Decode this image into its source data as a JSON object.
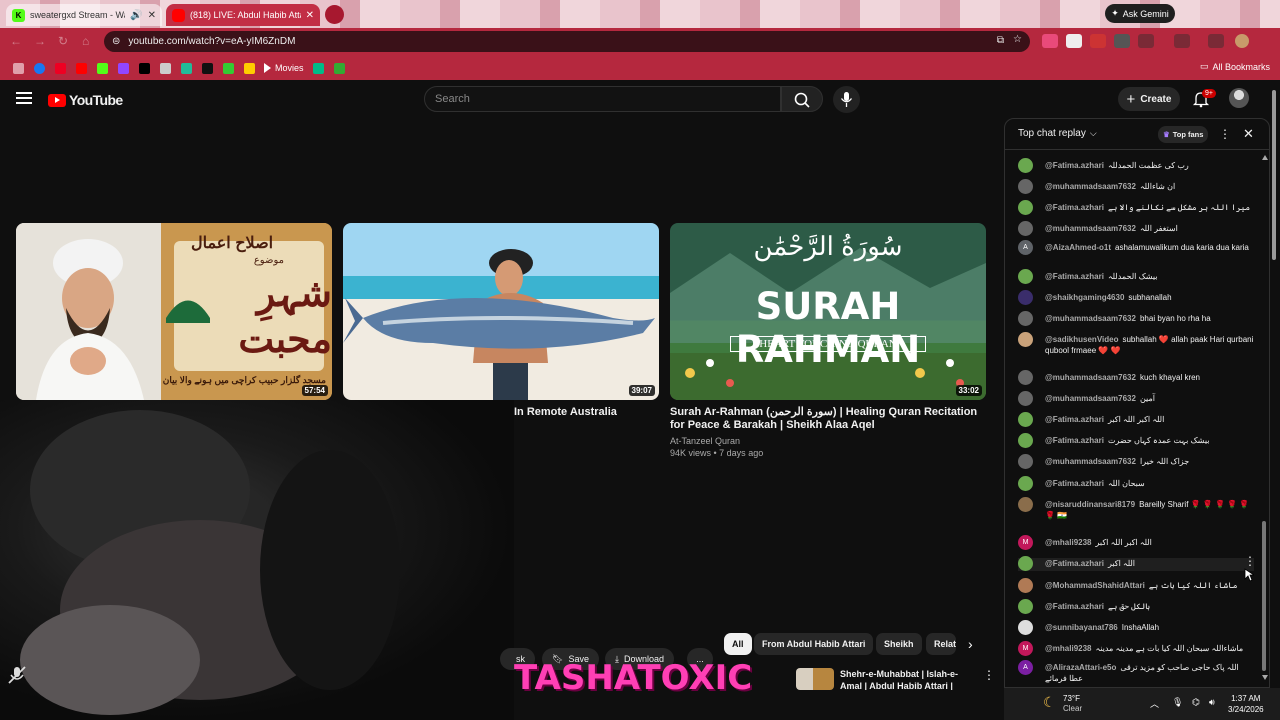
{
  "browser": {
    "tabs": [
      {
        "title": "sweatergxd Stream - Watch",
        "favicon_letter": "K"
      },
      {
        "title": "(818) ​LIVE: Abdul Habib Atta"
      }
    ],
    "gemini_label": "Ask Gemini",
    "url": "youtube.com/watch?v=eA-yIM6ZnDM",
    "bookmarks_folder": "Movies",
    "all_bookmarks": "All Bookmarks"
  },
  "masthead": {
    "logo_text": "YouTube",
    "search_placeholder": "Search",
    "create_label": "Create",
    "notif_count": "9+"
  },
  "videos": [
    {
      "duration": "57:54",
      "thumb_text_1": "اصلاح اعمال",
      "thumb_text_2": "شہرِ محبت",
      "thumb_caption": "مسجد گلزار حبیب کراچی میں ہونے والا بیان",
      "thumb_label_left": "موضوع"
    },
    {
      "duration": "39:07",
      "title_partial": "In Remote Australia"
    },
    {
      "duration": "33:02",
      "thumb_arabic": "سُورَةُ الرَّحْمَٰن",
      "thumb_title": "SURAH RAHMAN",
      "thumb_subtitle": "HEART TOUCHING QURAN",
      "title": "Surah Ar-Rahman (سورة الرحمن) | Healing Quran Recitation for Peace & Barakah | Sheikh Alaa Aqel",
      "channel": "At-Tanzeel Quran",
      "meta": "94K views • 7 days ago"
    }
  ],
  "player_actions": {
    "ask_partial": "sk",
    "save": "Save",
    "download": "Download",
    "more": "..."
  },
  "filter_chips": [
    "All",
    "From Abdul Habib Attari",
    "Sheikh",
    "Relat"
  ],
  "related": {
    "title_line1": "Shehr-e-Muhabbat | Islah-e-",
    "title_line2": "Amal | Abdul Habib Attari |"
  },
  "overlay_text": "TASHATOXIC",
  "chat": {
    "header": "Top chat replay",
    "top_fans": "Top fans",
    "messages": [
      {
        "author": "@Fatima.azhari",
        "text": "رب کی عظمت الحمدللہ",
        "color": "#6aa84f"
      },
      {
        "author": "@muhammadsaam7632",
        "text": "ان شاءاللہ",
        "color": "#666666"
      },
      {
        "author": "@Fatima.azhari",
        "text": "میرا اللہ ہر مشکل سے نکالنے والا ہے",
        "color": "#6aa84f"
      },
      {
        "author": "@muhammadsaam7632",
        "text": "استغفر اللہ",
        "color": "#666666"
      },
      {
        "author": "@AizaAhmed-o1t",
        "text": "ashalamuwalikum dua karia dua karia",
        "color": "#5f6368",
        "letter": "A"
      },
      {
        "author": "@Fatima.azhari",
        "text": "بیشک الحمدللہ",
        "color": "#6aa84f"
      },
      {
        "author": "@shaikhgaming4630",
        "text": "subhanallah",
        "color": "#3a2d6b"
      },
      {
        "author": "@muhammadsaam7632",
        "text": "bhai byan ho rha ha",
        "color": "#666666"
      },
      {
        "author": "@sadikhusenVideo",
        "text": "subhallah ❤️ allah paak Hari qurbani qubool frmaee ❤️ ❤️",
        "color": "#c9a27a"
      },
      {
        "author": "@muhammadsaam7632",
        "text": "kuch khayal kren",
        "color": "#666666"
      },
      {
        "author": "@muhammadsaam7632",
        "text": "آمین",
        "color": "#666666"
      },
      {
        "author": "@Fatima.azhari",
        "text": "اللہ اکبر اللہ اکبر",
        "color": "#6aa84f"
      },
      {
        "author": "@Fatima.azhari",
        "text": "بیشک بہت عمدہ کہاں حضرت",
        "color": "#6aa84f"
      },
      {
        "author": "@muhammadsaam7632",
        "text": "جزاک اللہ خیرا",
        "color": "#666666"
      },
      {
        "author": "@Fatima.azhari",
        "text": "سبحان اللہ",
        "color": "#6aa84f"
      },
      {
        "author": "@nisaruddinansari8179",
        "text": "Bareilly Sharif 🌹 🌹 🌹 🌹 🌹 🌹 🇮🇳",
        "color": "#8a6d4b"
      },
      {
        "author": "@mhali9238",
        "text": "اللہ اکبر اللہ اکبر",
        "color": "#c2185b",
        "letter": "M"
      },
      {
        "author": "@Fatima.azhari",
        "text": "اللہ اکبر",
        "color": "#6aa84f"
      },
      {
        "author": "@MohammadShahidAttari",
        "text": "ماشاء اللہ کیا بات ہے",
        "color": "#b07a55"
      },
      {
        "author": "@Fatima.azhari",
        "text": "بالکل حق ہے",
        "color": "#6aa84f"
      },
      {
        "author": "@sunnibayanat786",
        "text": "InshaAllah",
        "color": "#dddddd"
      },
      {
        "author": "@mhali9238",
        "text": "ماشاءاللہ سبحان اللہ کیا بات ہے مدینہ مدینہ",
        "color": "#c2185b",
        "letter": "M"
      },
      {
        "author": "@AlirazaAttari-e5o",
        "text": "اللہ پاک حاجی صاحب کو مزید ترقی عطا فرمائے",
        "color": "#7b1fa2",
        "letter": "A"
      }
    ]
  },
  "taskbar": {
    "temp": "73°F",
    "condition": "Clear",
    "time": "1:37 AM",
    "date": "3/24/2026"
  }
}
